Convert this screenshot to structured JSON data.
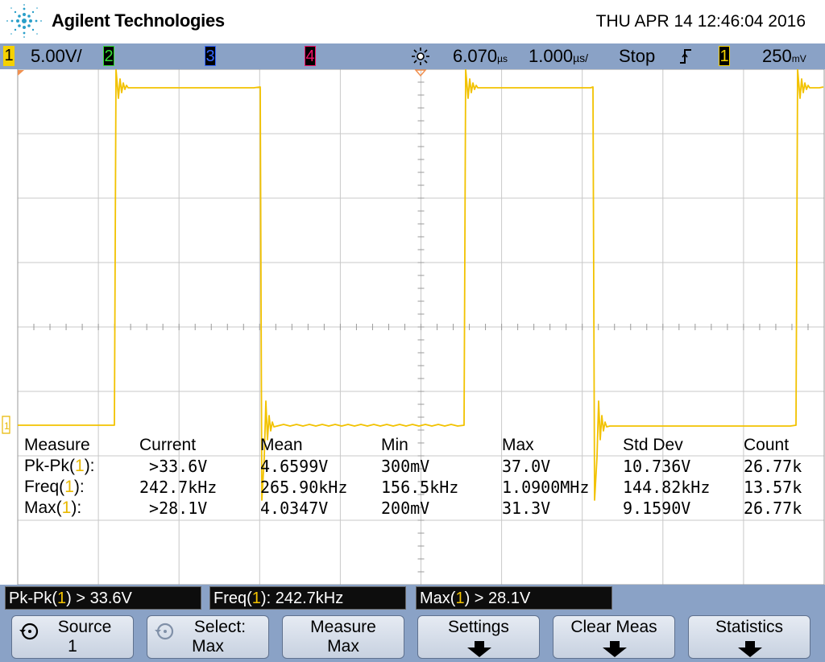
{
  "header": {
    "brand": "Agilent Technologies",
    "datetime": "THU APR 14 12:46:04 2016",
    "logo_icon": "agilent-spark-icon"
  },
  "status_bar": {
    "ch1_label": "1",
    "ch1_scale": "5.00V/",
    "ch2_label": "2",
    "ch3_label": "3",
    "ch4_label": "4",
    "trigger_icon": "trigger-sun-icon",
    "time_position": "6.070",
    "time_position_unit": "µs",
    "time_scale": "1.000",
    "time_scale_unit": "µs/",
    "run_state": "Stop",
    "trigger_edge_icon": "rising-edge-icon",
    "trigger_source": "1",
    "trigger_level": "250",
    "trigger_level_unit": "mV",
    "colors": {
      "ch1": "#f5d100",
      "ch2": "#33dd33",
      "ch3": "#3366ff",
      "ch4": "#ee1166",
      "bar": "#8aa2c6"
    }
  },
  "waveform": {
    "channel": "1",
    "ground_marker": "1",
    "color": "#f2c200"
  },
  "measurements": {
    "headers": [
      "Measure",
      "Current",
      "Mean",
      "Min",
      "Max",
      "Std Dev",
      "Count"
    ],
    "rows": [
      {
        "name": "Pk-Pk(",
        "ch": "1",
        "suffix": "):",
        "current": " >33.6V",
        "mean": "4.6599V",
        "min": "300mV",
        "max": "37.0V",
        "std": "10.736V",
        "count": "26.77k"
      },
      {
        "name": "Freq(",
        "ch": "1",
        "suffix": "):",
        "current": "242.7kHz",
        "mean": "265.90kHz",
        "min": "156.5kHz",
        "max": "1.0900MHz",
        "std": "144.82kHz",
        "count": "13.57k"
      },
      {
        "name": "Max(",
        "ch": "1",
        "suffix": "):",
        "current": " >28.1V",
        "mean": "4.0347V",
        "min": "200mV",
        "max": "31.3V",
        "std": "9.1590V",
        "count": "26.77k"
      }
    ]
  },
  "readouts": [
    {
      "pre": "Pk-Pk(",
      "ch": "1",
      "post": ") > 33.6V"
    },
    {
      "pre": "Freq(",
      "ch": "1",
      "post": "): 242.7kHz"
    },
    {
      "pre": "Max(",
      "ch": "1",
      "post": ") > 28.1V"
    }
  ],
  "softkeys": [
    {
      "line1": "Source",
      "line2": "1",
      "icon": "rotate-knob-icon"
    },
    {
      "line1": "Select:",
      "line2": "Max",
      "icon": "rotate-knob-icon"
    },
    {
      "line1": "Measure",
      "line2": "Max"
    },
    {
      "line1": "Settings",
      "arrow": "down-arrow-icon"
    },
    {
      "line1": "Clear Meas",
      "arrow": "down-arrow-icon"
    },
    {
      "line1": "Statistics",
      "arrow": "down-arrow-icon"
    }
  ]
}
